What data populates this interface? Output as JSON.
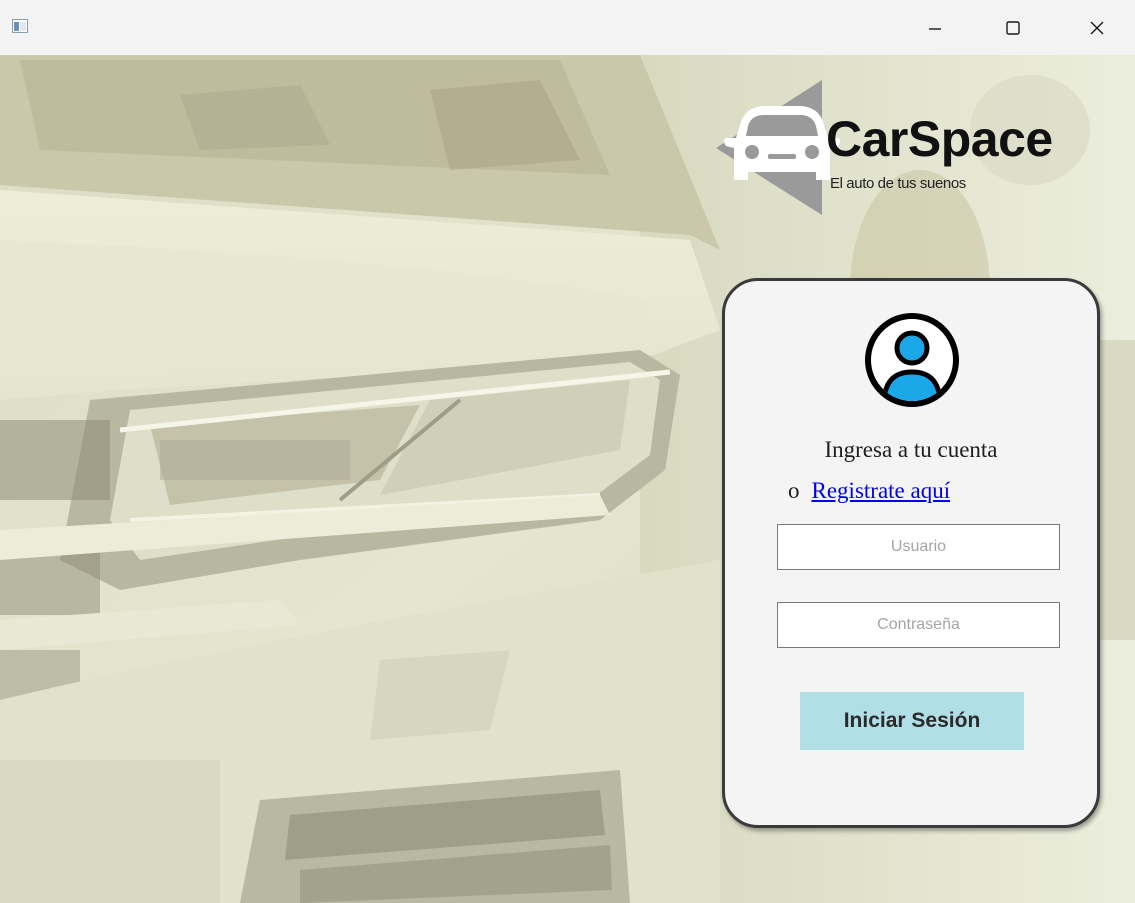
{
  "window": {
    "icon": "app-window-icon",
    "controls": [
      "minimize-icon",
      "maximize-icon",
      "close-icon"
    ]
  },
  "brand": {
    "name": "CarSpace",
    "tagline": "El auto de tus suenos"
  },
  "login": {
    "avatar_icon": "user-circle-icon",
    "prompt": "Ingresa a tu cuenta",
    "or_text": "o",
    "register_link": "Registrate aquí",
    "username_placeholder": "Usuario",
    "password_placeholder": "Contraseña",
    "submit_label": "Iniciar Sesión"
  },
  "colors": {
    "card_background": "#f4f4f4",
    "card_border": "#3a3a3a",
    "button_background": "#b0dfe5",
    "avatar_blue": "#1ba8e8",
    "link_color": "#0000ee"
  }
}
